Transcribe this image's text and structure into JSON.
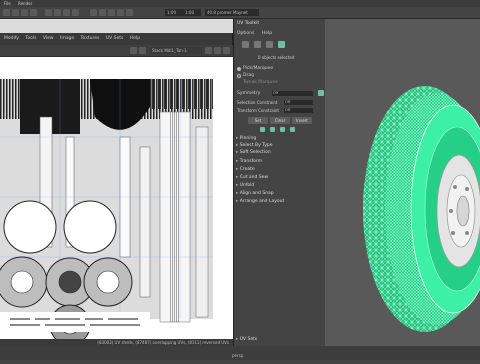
{
  "top_menu": [
    "File",
    "Render"
  ],
  "toolbar": {
    "field_a": "1:00",
    "field_b": "1:00",
    "field_c": "40.8 promer Maynet"
  },
  "uv_editor": {
    "menus": [
      "Modify",
      "Tools",
      "View",
      "Image",
      "Textures",
      "UV Sets",
      "Help"
    ],
    "texture_field": "Stack Mdl1_Tan-1",
    "status": "(83003) UV shells, (87487) overlapping UVs, (8111) reversed UVs"
  },
  "uv_toolkit": {
    "title": "UV Toolkit",
    "menus": [
      "Options",
      "Help"
    ],
    "selection_summary": "0 objects selected",
    "pick_label": "Pick/Marquee",
    "drag_label": "Drag",
    "tweak_label": "Tweak Marquee",
    "symmetry_label": "Symmetry",
    "symmetry_value": "Off",
    "selection_constraint_label": "Selection Constraint",
    "selection_constraint_value": "Off",
    "transform_constraint_label": "Transform Constraint",
    "transform_constraint_value": "Off",
    "buttons": [
      "Set",
      "Clear",
      "Invert"
    ],
    "sections": [
      "Pinning",
      "Select By Type",
      "Soft Selection",
      "Transform",
      "Create",
      "Cut and Sew",
      "Unfold",
      "Align and Snap",
      "Arrange and Layout"
    ],
    "footer_section": "UV Sets"
  },
  "viewport": {
    "bottom_label": "persp"
  },
  "colors": {
    "wire": "#2de39a",
    "panel": "#444444",
    "uv_bg": "#ffffff"
  }
}
